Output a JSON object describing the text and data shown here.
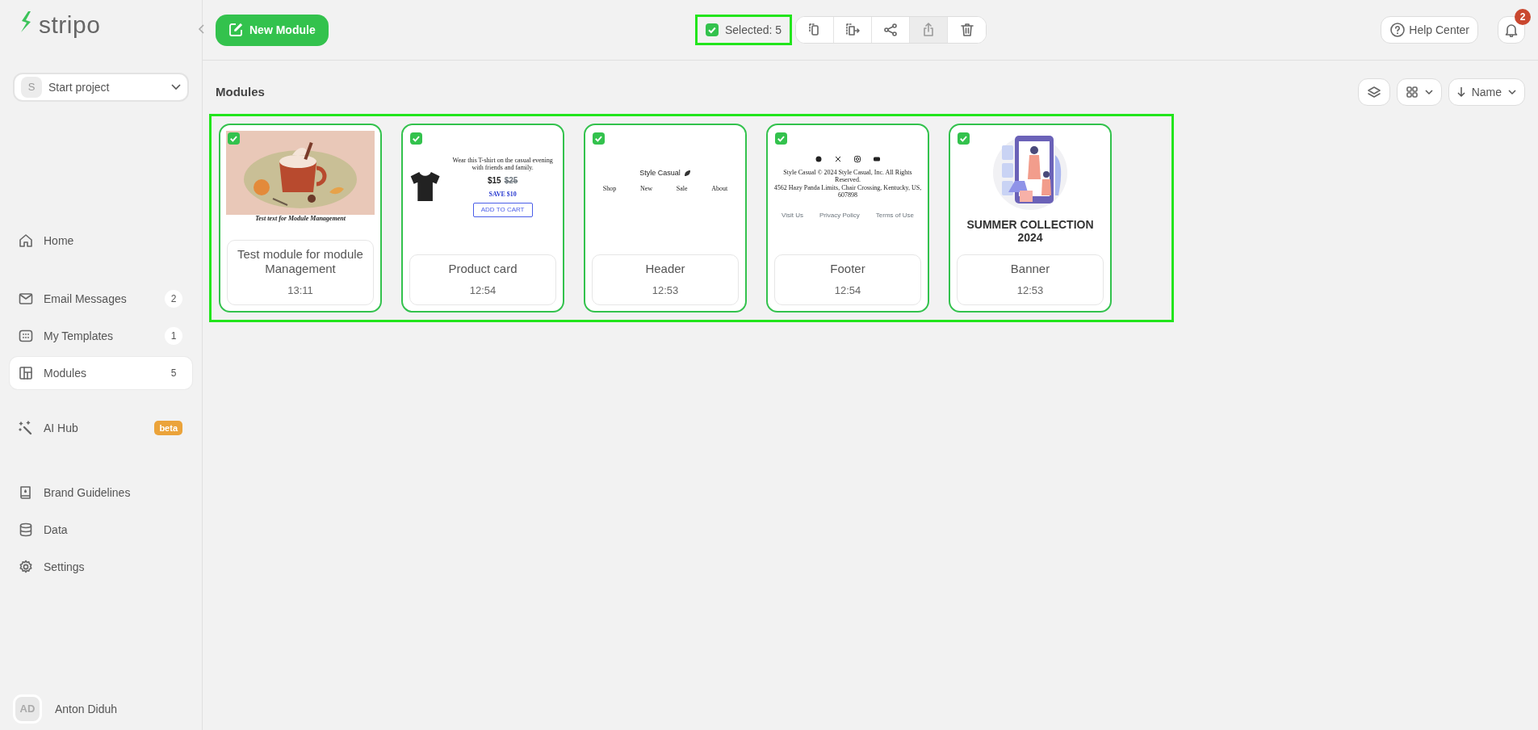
{
  "sidebar": {
    "logo": "stripo",
    "project": {
      "initial": "S",
      "name": "Start project"
    },
    "groups": [
      [
        {
          "label": "Home",
          "selected": false
        }
      ],
      [
        {
          "label": "Email Messages",
          "count": "2",
          "selected": false
        },
        {
          "label": "My Templates",
          "count": "1",
          "selected": false
        },
        {
          "label": "Modules",
          "count": "5",
          "selected": true
        }
      ],
      [
        {
          "label": "AI Hub",
          "tag": "beta",
          "selected": false
        }
      ],
      [
        {
          "label": "Brand Guidelines",
          "selected": false
        },
        {
          "label": "Data",
          "selected": false
        },
        {
          "label": "Settings",
          "selected": false
        }
      ]
    ],
    "user": {
      "initials": "AD",
      "name": "Anton Diduh"
    }
  },
  "toolbar": {
    "new_button": "New Module",
    "selection": {
      "checked": true,
      "label": "Selected: 5"
    },
    "actions": [
      {
        "disabled": false
      },
      {
        "disabled": false
      },
      {
        "disabled": false
      },
      {
        "disabled": true
      },
      {
        "disabled": false
      }
    ],
    "help": "Help Center",
    "notifications": "2"
  },
  "heading": "Modules",
  "sort": "Name",
  "cards": [
    {
      "title": "Test module for module Management",
      "time": "13:11",
      "selected": true,
      "thumbnail": {
        "kind": "picture",
        "caption": "Test text for Module Management"
      }
    },
    {
      "title": "Product card",
      "time": "12:54",
      "selected": true,
      "thumbnail": {
        "kind": "product",
        "description": "Wear this T-shirt on the casual evening with friends and family.",
        "price": "$15",
        "old_price": "$25",
        "discount": "SAVE $10",
        "button": "ADD TO CART"
      }
    },
    {
      "title": "Header",
      "time": "12:53",
      "selected": true,
      "thumbnail": {
        "kind": "header",
        "brand": "Style Casual",
        "links": [
          "Shop",
          "New",
          "Sale",
          "About"
        ]
      }
    },
    {
      "title": "Footer",
      "time": "12:54",
      "selected": true,
      "thumbnail": {
        "kind": "footer",
        "lines": [
          "Style Casual © 2024 Style Casual, Inc. All Rights Reserved.",
          "4562 Hazy Panda Limits, Chair Crossing, Kentucky, US, 607898"
        ],
        "links": [
          "Visit Us",
          "Privacy Policy",
          "Terms of Use"
        ]
      }
    },
    {
      "title": "Banner",
      "time": "12:53",
      "selected": true,
      "thumbnail": {
        "kind": "banner",
        "heading": "SUMMER COLLECTION 2024"
      }
    }
  ]
}
